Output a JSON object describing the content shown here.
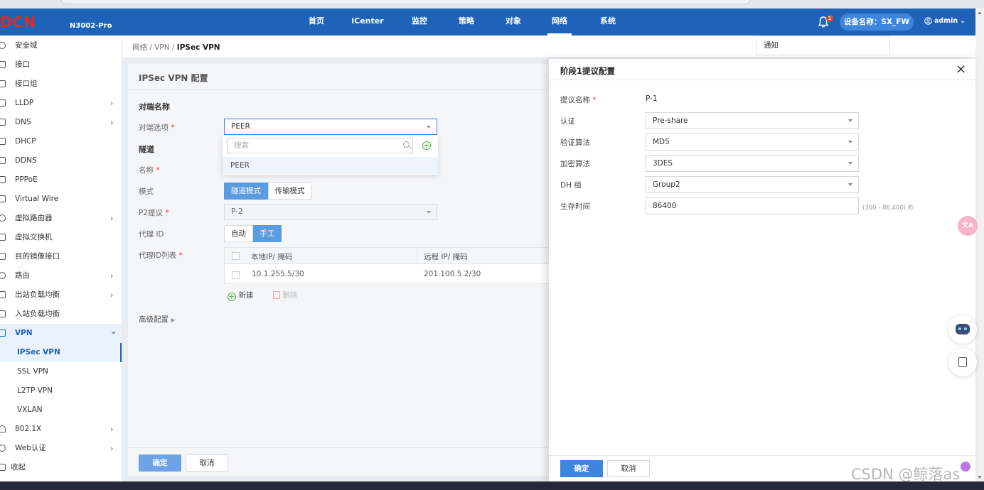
{
  "header": {
    "logo": "DCN",
    "model": "N3002-Pro",
    "nav": [
      "首页",
      "iCenter",
      "监控",
      "策略",
      "对象",
      "网络",
      "系统"
    ],
    "active_nav": "网络",
    "notif_count": "1",
    "device_label": "设备名称：SX_FW",
    "user": "admin"
  },
  "sidebar": {
    "items": [
      {
        "label": "安全域",
        "icon": "globe-icon"
      },
      {
        "label": "接口",
        "icon": "interface-icon"
      },
      {
        "label": "接口组",
        "icon": "interface-group-icon"
      },
      {
        "label": "LLDP",
        "icon": "lldp-icon",
        "arrow": "›"
      },
      {
        "label": "DNS",
        "icon": "dns-icon",
        "arrow": "›"
      },
      {
        "label": "DHCP",
        "icon": "dhcp-icon"
      },
      {
        "label": "DDNS",
        "icon": "ddns-icon"
      },
      {
        "label": "PPPoE",
        "icon": "pppoe-icon"
      },
      {
        "label": "Virtual Wire",
        "icon": "virtual-wire-icon"
      },
      {
        "label": "虚拟路由器",
        "icon": "virtual-router-icon",
        "arrow": "›"
      },
      {
        "label": "虚拟交换机",
        "icon": "virtual-switch-icon"
      },
      {
        "label": "目的镜像接口",
        "icon": "mirror-icon"
      },
      {
        "label": "路由",
        "icon": "route-icon",
        "arrow": "›"
      },
      {
        "label": "出站负载均衡",
        "icon": "outbound-lb-icon",
        "arrow": "›"
      },
      {
        "label": "入站负载均衡",
        "icon": "inbound-lb-icon"
      },
      {
        "label": "VPN",
        "icon": "vpn-icon",
        "arrow": "⌄"
      }
    ],
    "vpn_sub": [
      "IPSec VPN",
      "SSL VPN",
      "L2TP VPN",
      "VXLAN"
    ],
    "after": [
      {
        "label": "802.1X",
        "icon": "wifi-icon",
        "arrow": "›"
      },
      {
        "label": "Web认证",
        "icon": "web-auth-icon",
        "arrow": "›"
      },
      {
        "label": "收起",
        "icon": "collapse-icon"
      }
    ]
  },
  "breadcrumb": {
    "path": "网络 / VPN / ",
    "current": "IPSec VPN"
  },
  "main": {
    "title": "IPSec VPN 配置",
    "peer_section": "对端名称",
    "peer_label": "对端选项",
    "peer_value": "PEER",
    "search_placeholder": "搜索",
    "peer_option": "PEER",
    "tunnel_section": "隧道",
    "name_label": "名称",
    "mode_label": "模式",
    "mode_tunnel": "隧道模式",
    "mode_transport": "传输模式",
    "p2_label": "P2提议",
    "p2_value": "P-2",
    "proxy_label": "代理 ID",
    "proxy_auto": "自动",
    "proxy_manual": "手工",
    "proxy_list_label": "代理ID列表",
    "col_local": "本地IP/ 掩码",
    "col_remote": "远程 IP/ 掩码",
    "row_local": "10.1.255.5/30",
    "row_remote": "201.100.5.2/30",
    "new_label": "新建",
    "delete_label": "删除",
    "advanced": "高级配置",
    "ok": "确定",
    "cancel": "取消",
    "asterisk": "*"
  },
  "notif_popup": "通知",
  "panel": {
    "title": "阶段1提议配置",
    "name_label": "提议名称",
    "name_value": "P-1",
    "auth_label": "认证",
    "auth_value": "Pre-share",
    "hash_label": "验证算法",
    "hash_value": "MD5",
    "enc_label": "加密算法",
    "enc_value": "3DES",
    "dh_label": "DH 组",
    "dh_value": "Group2",
    "life_label": "生存时间",
    "life_value": "86400",
    "life_hint": "(300 - 86,400) 秒",
    "ok": "确定",
    "cancel": "取消"
  },
  "watermark": "CSDN @鲸落as",
  "colors": {
    "header": "#1e63b8",
    "accent": "#3d85dd",
    "active_bg": "#e8f1fc"
  }
}
